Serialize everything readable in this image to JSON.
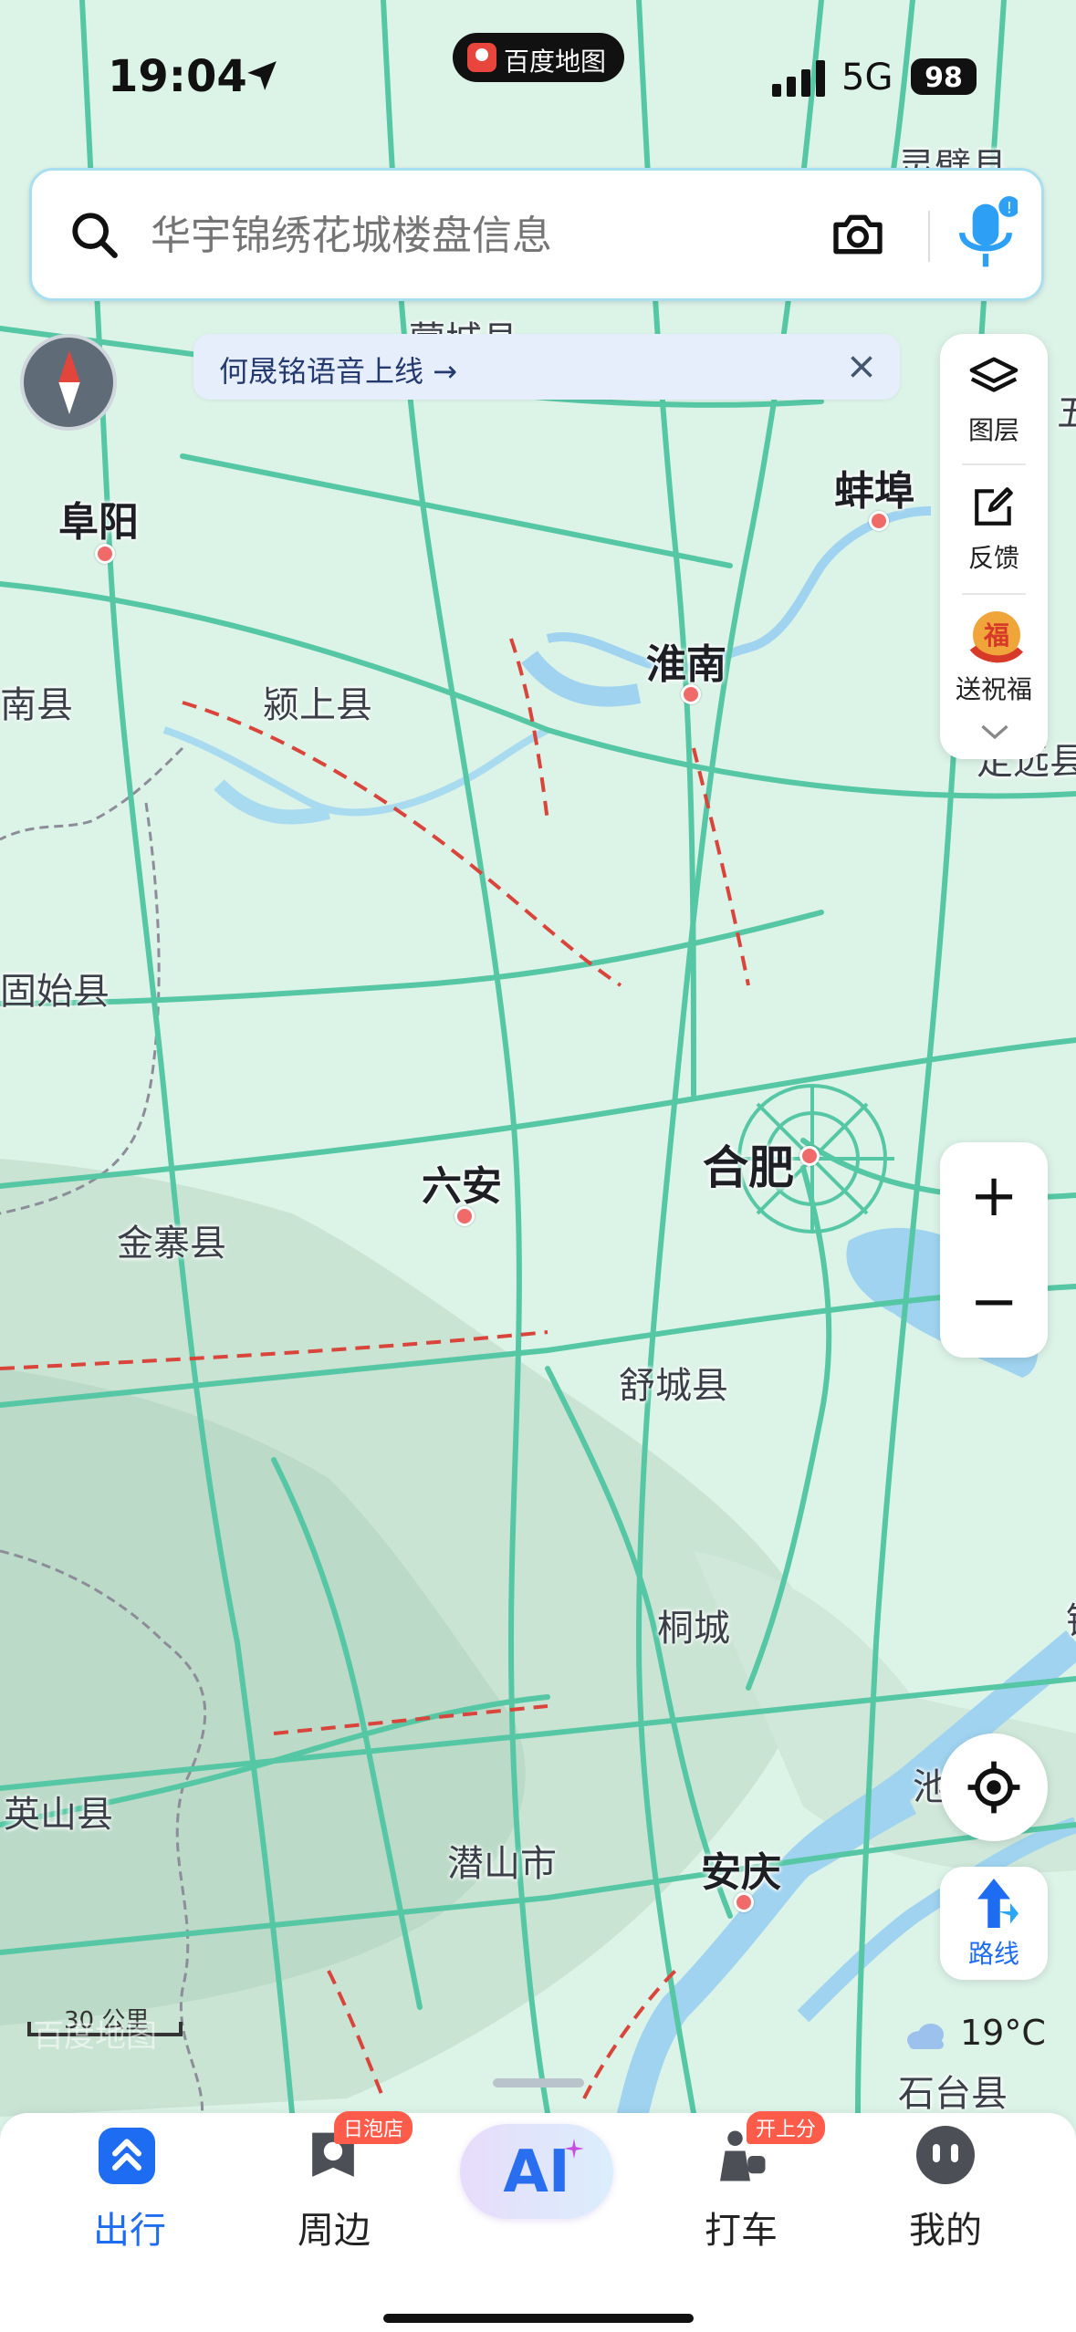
{
  "status_bar": {
    "time": "19:04",
    "network": "5G",
    "battery": "98"
  },
  "app_pill": {
    "label": "百度地图"
  },
  "search": {
    "placeholder": "华宇锦绣花城楼盘信息"
  },
  "notice": {
    "text": "何晟铭语音上线 →"
  },
  "right_panel": {
    "layers": "图层",
    "feedback": "反馈",
    "promo": "送祝福"
  },
  "zoom": {
    "in": "+",
    "out": "−"
  },
  "route": {
    "label": "路线"
  },
  "weather": {
    "temp": "19°C"
  },
  "scale": {
    "label": "30 公里",
    "watermark": "百度地图"
  },
  "map_labels": {
    "cities": [
      "阜阳",
      "淮南",
      "蚌埠",
      "六安",
      "合肥",
      "安庆"
    ],
    "counties": [
      "颍上县",
      "金寨县",
      "舒城县",
      "桐城",
      "潜山市",
      "英山县",
      "石台县",
      "南县",
      "固始县",
      "蒙城县",
      "灵璧县",
      "定远县",
      "五",
      "池",
      "铜"
    ]
  },
  "tabs": [
    {
      "label": "出行",
      "active": true
    },
    {
      "label": "周边",
      "badge": "日泡店"
    },
    {
      "label": "AI"
    },
    {
      "label": "打车",
      "badge": "开上分"
    },
    {
      "label": "我的"
    }
  ],
  "colors": {
    "accent": "#1e6cf2",
    "road": "#52c9a6",
    "water": "#a7d9f2",
    "congestion": "#d33a3a"
  }
}
